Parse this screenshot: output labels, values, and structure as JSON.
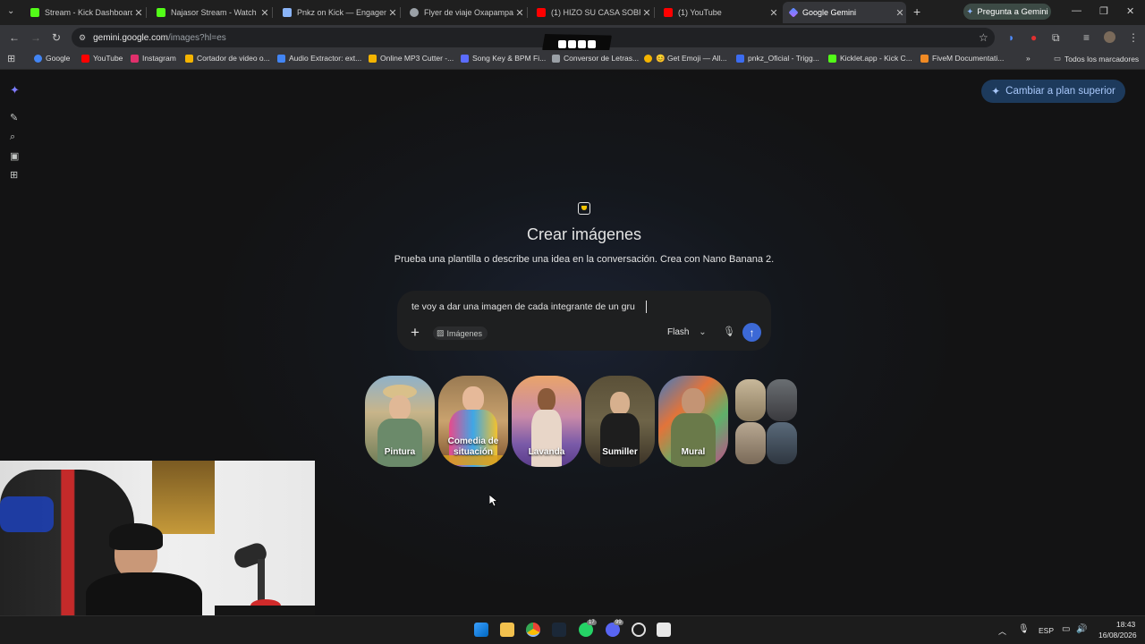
{
  "browser": {
    "tabs": [
      {
        "title": "Stream - Kick Dashboard",
        "color": "#53fc18"
      },
      {
        "title": "Najasor Stream - Watch Li",
        "color": "#53fc18"
      },
      {
        "title": "Pnkz on Kick — Engageme",
        "color": "#8ab4f8"
      },
      {
        "title": "Flyer de viaje Oxapampa",
        "color": "#9aa0a6"
      },
      {
        "title": "(1) HIZO SU CASA SOBRE",
        "color": "#ff0000"
      },
      {
        "title": "(1) YouTube",
        "color": "#ff0000"
      },
      {
        "title": "Google Gemini",
        "color": "#8ab4f8",
        "active": true
      }
    ],
    "new_tab": "+",
    "ask_gemini": "Pregunta a Gemini",
    "url_host": "gemini.google.com",
    "url_path": "/images?hl=es",
    "bookmarks": [
      {
        "label": "Google",
        "color": "#4285f4"
      },
      {
        "label": "YouTube",
        "color": "#ff0000"
      },
      {
        "label": "Instagram",
        "color": "#e1306c"
      },
      {
        "label": "Cortador de video o...",
        "color": "#f4b400"
      },
      {
        "label": "Audio Extractor: ext...",
        "color": "#4285f4"
      },
      {
        "label": "Online MP3 Cutter -...",
        "color": "#f4b400"
      },
      {
        "label": "Song Key & BPM Fi...",
        "color": "#5b6cff"
      },
      {
        "label": "Conversor de Letras...",
        "color": "#9aa0a6"
      },
      {
        "label": "😊 Get Emoji — All...",
        "color": "#f4b400"
      },
      {
        "label": "pnkz_Oficial - Trigg...",
        "color": "#3c6cf0"
      },
      {
        "label": "Kicklet.app - Kick C...",
        "color": "#53fc18"
      },
      {
        "label": "FiveM Documentati...",
        "color": "#f08a24"
      }
    ],
    "all_bookmarks": "Todos los marcadores"
  },
  "gemini": {
    "upgrade": "Cambiar a plan superior",
    "title": "Crear imágenes",
    "subtitle": "Prueba una plantilla o describe una idea en la conversación. Crea con Nano Banana 2.",
    "prompt_text": "te voy a dar una imagen de cada integrante de un gru",
    "chip": "Imágenes",
    "model": "Flash",
    "templates": [
      {
        "label": "Pintura"
      },
      {
        "label": "Comedia de situación"
      },
      {
        "label": "Lavanda"
      },
      {
        "label": "Sumiller"
      },
      {
        "label": "Mural"
      }
    ]
  },
  "taskbar": {
    "lang": "ESP",
    "time": "18:43",
    "date": "16/08/2026",
    "whatsapp_badge": "17",
    "discord_badge": "99"
  }
}
